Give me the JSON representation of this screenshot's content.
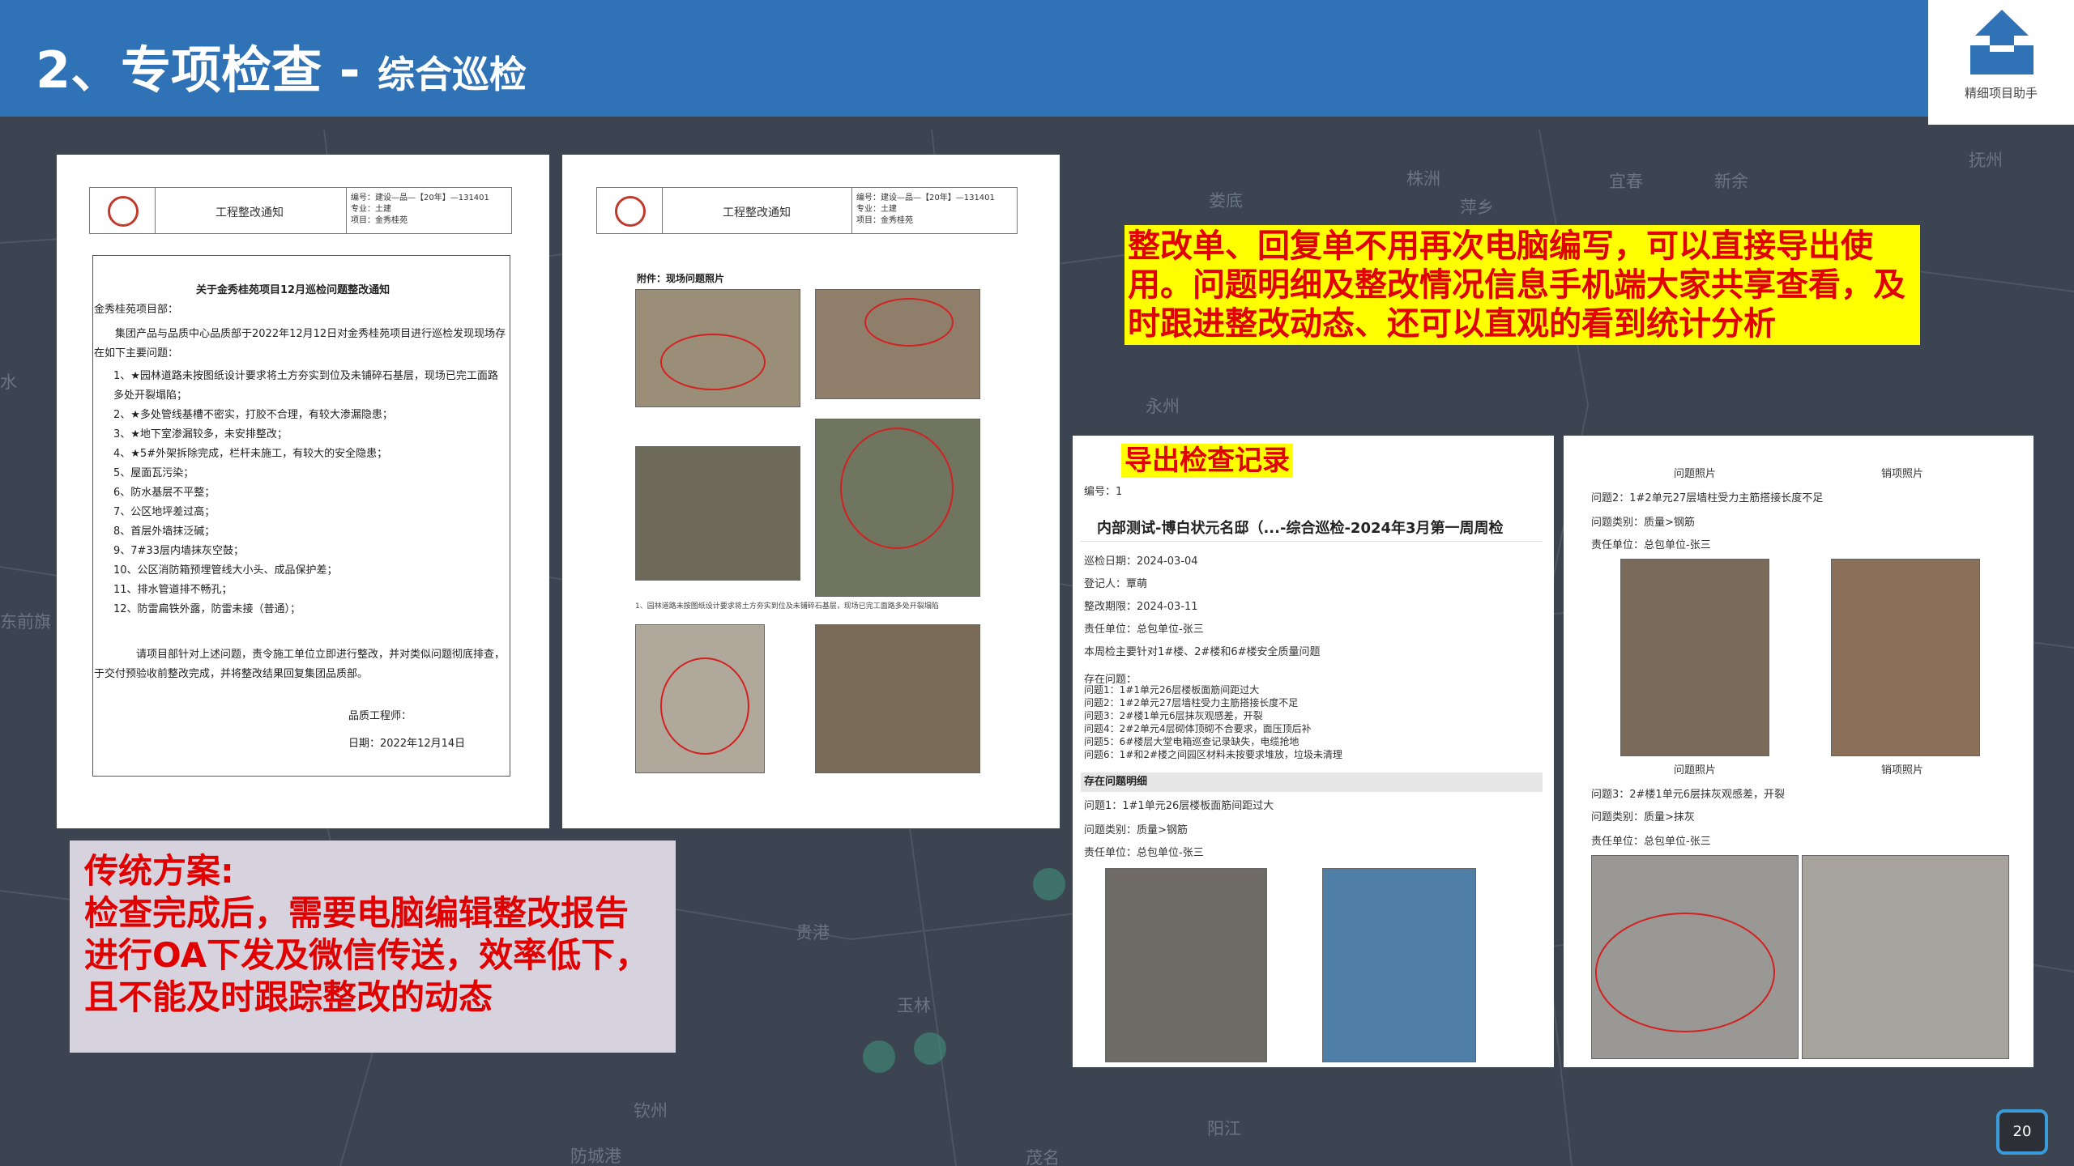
{
  "header": {
    "title_main": "2、专项检查",
    "title_sep": " - ",
    "title_sub": "综合巡检"
  },
  "logo": {
    "text": "精细项目助手"
  },
  "map_cities": [
    "株洲",
    "宜春",
    "新余",
    "抚州",
    "娄底",
    "萍乡",
    "永州",
    "贵港",
    "玉林",
    "钦州",
    "阳江",
    "茂名",
    "防城港",
    "水",
    "东前旗"
  ],
  "doc_left": {
    "header_title": "工程整改通知",
    "meta_no": "编号：建设—品—【20年】—131401",
    "meta_major": "专业：土建",
    "meta_project": "项目：金秀桂苑",
    "notice_title": "关于金秀桂苑项目12月巡检问题整改通知",
    "salutation": "金秀桂苑项目部：",
    "body": "集团产品与品质中心品质部于2022年12月12日对金秀桂苑项目进行巡检发现现场存在如下主要问题：",
    "items": [
      "1、★园林道路未按图纸设计要求将土方夯实到位及未铺碎石基层，现场已完工面路多处开裂塌陷；",
      "2、★多处管线基槽不密实，打胶不合理，有较大渗漏隐患；",
      "3、★地下室渗漏较多，未安排整改；",
      "4、★5#外架拆除完成，栏杆未施工，有较大的安全隐患；",
      "5、屋面瓦污染；",
      "6、防水基层不平整；",
      "7、公区地坪差过高；",
      "8、首层外墙抹泛碱；",
      "9、7#33层内墙抹灰空鼓；",
      "10、公区消防箱预埋管线大小头、成品保护差；",
      "11、排水管道排不畅孔；",
      "12、防雷扁铁外露，防雷未接（普通）；"
    ],
    "closing": "请项目部针对上述问题，责令施工单位立即进行整改，并对类似问题彻底排查，于交付预验收前整改完成，并将整改结果回复集团品质部。",
    "sign": "品质工程师：",
    "date": "日期：2022年12月14日"
  },
  "doc_right": {
    "header_title": "工程整改通知",
    "meta_no": "编号：建设—品—【20年】—131401",
    "meta_major": "专业：土建",
    "meta_project": "项目：金秀桂苑",
    "attachment": "附件：现场问题照片",
    "caption": "1、园林道路未按图纸设计要求将土方夯实到位及未铺碎石基层，现场已完工面路多处开裂塌陷"
  },
  "callout_top": {
    "text": "整改单、回复单不用再次电脑编写，可以直接导出使用。问题明细及整改情况信息手机端大家共享查看，及时跟进整改动态、还可以直观的看到统计分析"
  },
  "callout_export": {
    "text": "导出检查记录"
  },
  "traditional": {
    "heading": "传统方案:",
    "lines": [
      "检查完成后，需要电脑编辑整改报告",
      "进行OA下发及微信传送，效率低下，",
      "且不能及时跟踪整改的动态"
    ]
  },
  "record_left": {
    "no": "编号：1",
    "title": "内部测试-博白状元名邸（...-综合巡检-2024年3月第一周周检",
    "rows": [
      "巡检日期：2024-03-04",
      "登记人：覃萌",
      "整改期限：2024-03-11",
      "责任单位：总包单位-张三",
      "本周检主要针对1#楼、2#楼和6#楼安全质量问题"
    ],
    "problems_label": "存在问题：",
    "problems": [
      "问题1：1#1单元26层楼板面筋间距过大",
      "问题2：1#2单元27层墙柱受力主筋搭接长度不足",
      "问题3：2#楼1单元6层抹灰观感差，开裂",
      "问题4：2#2单元4层砌体顶砌不合要求，面压顶后补",
      "问题5：6#楼层大堂电箱巡查记录缺失，电缆抢地",
      "问题6：1#和2#楼之间园区材料未按要求堆放，垃圾未清理"
    ],
    "section": "存在问题明细",
    "detail": [
      "问题1：1#1单元26层楼板面筋间距过大",
      "问题类别：质量>钢筋",
      "责任单位：总包单位-张三"
    ]
  },
  "record_right": {
    "col_problem": "问题照片",
    "col_fix": "销项照片",
    "block1": [
      "问题2：1#2单元27层墙柱受力主筋搭接长度不足",
      "问题类别：质量>钢筋",
      "责任单位：总包单位-张三"
    ],
    "block2": [
      "问题3：2#楼1单元6层抹灰观感差，开裂",
      "问题类别：质量>抹灰",
      "责任单位：总包单位-张三"
    ]
  },
  "page_number": "20",
  "colors": {
    "header": "#2f72b6",
    "callout_bg": "#ffff00",
    "callout_text": "#e00000",
    "background": "#3b4450"
  }
}
